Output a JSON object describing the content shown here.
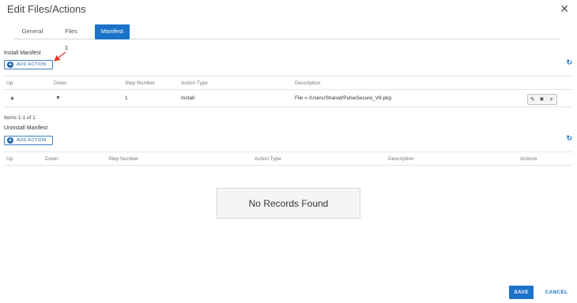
{
  "dialog": {
    "title": "Edit Files/Actions",
    "close_glyph": "✕"
  },
  "tabs": [
    {
      "label": "General",
      "active": false
    },
    {
      "label": "Files",
      "active": false
    },
    {
      "label": "Manifest",
      "active": true
    }
  ],
  "install": {
    "section_label": "Install Manifest",
    "add_action_label": "ADD ACTION",
    "columns": [
      "Up",
      "Down",
      "Step Number",
      "Action Type",
      "Description"
    ],
    "rows": [
      {
        "step": "1",
        "action_type": "Install",
        "description": "File = /Users/Shared/PulseSecure_V9.pkg"
      }
    ],
    "items_count": "Items 1-1 of 1"
  },
  "uninstall": {
    "section_label": "Uninstall Manifest",
    "add_action_label": "ADD ACTION",
    "columns": [
      "Up",
      "Down",
      "Step Number",
      "Action Type",
      "Description",
      "Actions"
    ],
    "empty_text": "No Records Found"
  },
  "annotation": {
    "number": "1",
    "color": "#e53b2c"
  },
  "footer": {
    "save_label": "SAVE",
    "cancel_label": "CANCEL"
  },
  "icons": {
    "refresh": "refresh-icon",
    "edit": "pencil-icon",
    "delete": "close-icon",
    "more": "chevron-down-icon",
    "up": "triangle-up-icon",
    "down": "triangle-down-icon"
  },
  "colors": {
    "accent": "#1a73c8"
  }
}
